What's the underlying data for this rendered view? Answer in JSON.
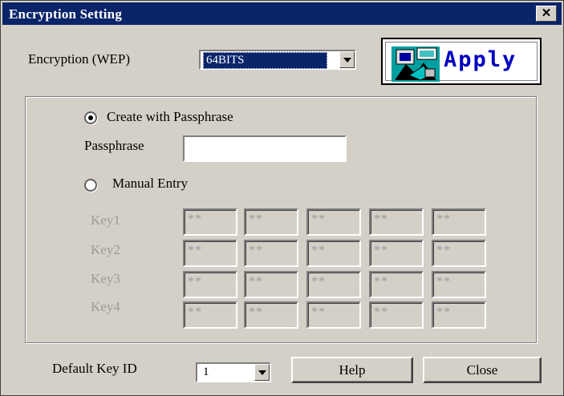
{
  "window": {
    "title": "Encryption Setting",
    "close_label": "x"
  },
  "encryption": {
    "label": "Encryption (WEP)",
    "selected": "64BITS"
  },
  "apply": {
    "label": "Apply"
  },
  "passphrase_mode": {
    "radio_label": "Create with Passphrase",
    "selected": true,
    "field_label": "Passphrase",
    "value": ""
  },
  "manual_mode": {
    "radio_label": "Manual Entry",
    "selected": false
  },
  "keys": [
    {
      "label": "Key1",
      "values": [
        "**",
        "**",
        "**",
        "**",
        "**"
      ]
    },
    {
      "label": "Key2",
      "values": [
        "**",
        "**",
        "**",
        "**",
        "**"
      ]
    },
    {
      "label": "Key3",
      "values": [
        "**",
        "**",
        "**",
        "**",
        "**"
      ]
    },
    {
      "label": "Key4",
      "values": [
        "**",
        "**",
        "**",
        "**",
        "**"
      ]
    }
  ],
  "default_key": {
    "label": "Default Key ID",
    "selected": "1"
  },
  "buttons": {
    "help": "Help",
    "close": "Close"
  },
  "colors": {
    "titlebar": "#0a246a",
    "dialog": "#d4d0c8",
    "apply_text": "#0000c0"
  }
}
